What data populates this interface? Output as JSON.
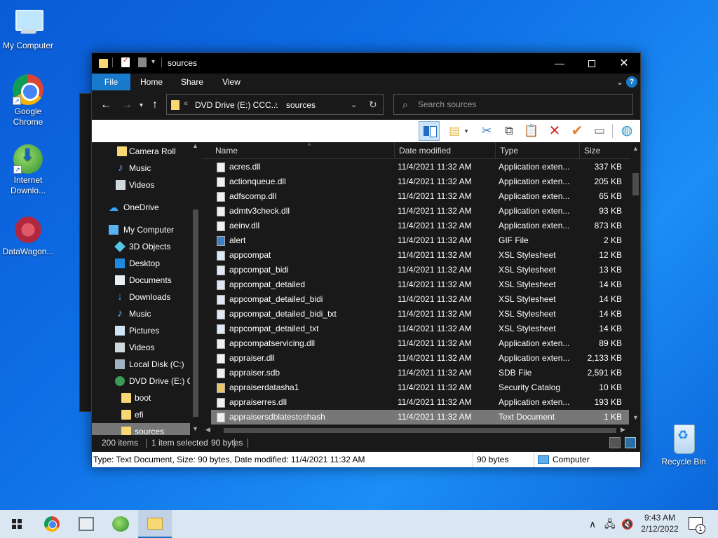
{
  "desktop": {
    "icons": [
      {
        "label": "My Computer"
      },
      {
        "label": "Google Chrome"
      },
      {
        "label": "Internet Downlo..."
      },
      {
        "label": "DataWagon..."
      },
      {
        "label": "Recycle Bin"
      }
    ]
  },
  "window": {
    "title": "sources",
    "controls": {
      "minimize": "—",
      "maximize": "",
      "close": "✕"
    },
    "ribbon_tabs": [
      "File",
      "Home",
      "Share",
      "View"
    ],
    "help": "?",
    "address": {
      "chevron": "«",
      "segments": [
        "DVD Drive (E:) CCC...",
        "sources"
      ],
      "arrow": "›"
    },
    "search": {
      "placeholder": "Search sources"
    },
    "nav_pane": [
      {
        "label": "Camera Roll",
        "icon": "folder-icon"
      },
      {
        "label": "Music",
        "icon": "music-icon"
      },
      {
        "label": "Videos",
        "icon": "videos-icon"
      },
      {
        "label": "OneDrive",
        "icon": "cloud-icon"
      },
      {
        "label": "My Computer",
        "icon": "computer-icon"
      },
      {
        "label": "3D Objects",
        "icon": "3d-objects-icon"
      },
      {
        "label": "Desktop",
        "icon": "desktop-icon"
      },
      {
        "label": "Documents",
        "icon": "documents-icon"
      },
      {
        "label": "Downloads",
        "icon": "downloads-icon"
      },
      {
        "label": "Music",
        "icon": "music-icon"
      },
      {
        "label": "Pictures",
        "icon": "pictures-icon"
      },
      {
        "label": "Videos",
        "icon": "videos-icon"
      },
      {
        "label": "Local Disk (C:)",
        "icon": "disk-icon"
      },
      {
        "label": "DVD Drive (E:) CC",
        "icon": "dvd-icon"
      },
      {
        "label": "boot",
        "icon": "folder-icon"
      },
      {
        "label": "efi",
        "icon": "folder-icon"
      },
      {
        "label": "sources",
        "icon": "folder-icon",
        "selected": true
      }
    ],
    "columns": {
      "name": "Name",
      "date": "Date modified",
      "type": "Type",
      "size": "Size"
    },
    "files": [
      {
        "name": "acres.dll",
        "date": "11/4/2021 11:32 AM",
        "type": "Application exten...",
        "size": "337 KB",
        "kind": "dll"
      },
      {
        "name": "actionqueue.dll",
        "date": "11/4/2021 11:32 AM",
        "type": "Application exten...",
        "size": "205 KB",
        "kind": "dll"
      },
      {
        "name": "adfscomp.dll",
        "date": "11/4/2021 11:32 AM",
        "type": "Application exten...",
        "size": "65 KB",
        "kind": "dll"
      },
      {
        "name": "admtv3check.dll",
        "date": "11/4/2021 11:32 AM",
        "type": "Application exten...",
        "size": "93 KB",
        "kind": "dll"
      },
      {
        "name": "aeinv.dll",
        "date": "11/4/2021 11:32 AM",
        "type": "Application exten...",
        "size": "873 KB",
        "kind": "dll"
      },
      {
        "name": "alert",
        "date": "11/4/2021 11:32 AM",
        "type": "GIF File",
        "size": "2 KB",
        "kind": "gif"
      },
      {
        "name": "appcompat",
        "date": "11/4/2021 11:32 AM",
        "type": "XSL Stylesheet",
        "size": "12 KB",
        "kind": "xsl"
      },
      {
        "name": "appcompat_bidi",
        "date": "11/4/2021 11:32 AM",
        "type": "XSL Stylesheet",
        "size": "13 KB",
        "kind": "xsl"
      },
      {
        "name": "appcompat_detailed",
        "date": "11/4/2021 11:32 AM",
        "type": "XSL Stylesheet",
        "size": "14 KB",
        "kind": "xsl"
      },
      {
        "name": "appcompat_detailed_bidi",
        "date": "11/4/2021 11:32 AM",
        "type": "XSL Stylesheet",
        "size": "14 KB",
        "kind": "xsl"
      },
      {
        "name": "appcompat_detailed_bidi_txt",
        "date": "11/4/2021 11:32 AM",
        "type": "XSL Stylesheet",
        "size": "14 KB",
        "kind": "xsl"
      },
      {
        "name": "appcompat_detailed_txt",
        "date": "11/4/2021 11:32 AM",
        "type": "XSL Stylesheet",
        "size": "14 KB",
        "kind": "xsl"
      },
      {
        "name": "appcompatservicing.dll",
        "date": "11/4/2021 11:32 AM",
        "type": "Application exten...",
        "size": "89 KB",
        "kind": "dll"
      },
      {
        "name": "appraiser.dll",
        "date": "11/4/2021 11:32 AM",
        "type": "Application exten...",
        "size": "2,133 KB",
        "kind": "dll"
      },
      {
        "name": "appraiser.sdb",
        "date": "11/4/2021 11:32 AM",
        "type": "SDB File",
        "size": "2,591 KB",
        "kind": "file"
      },
      {
        "name": "appraiserdatasha1",
        "date": "11/4/2021 11:32 AM",
        "type": "Security Catalog",
        "size": "10 KB",
        "kind": "cat"
      },
      {
        "name": "appraiserres.dll",
        "date": "11/4/2021 11:32 AM",
        "type": "Application exten...",
        "size": "193 KB",
        "kind": "dll"
      },
      {
        "name": "appraisersdblatestoshash",
        "date": "11/4/2021 11:32 AM",
        "type": "Text Document",
        "size": "1 KB",
        "kind": "txt",
        "selected": true
      }
    ],
    "status": {
      "count": "200 items",
      "selected": "1 item selected",
      "size": "90 bytes"
    },
    "details": {
      "info": "Type: Text Document, Size: 90 bytes, Date modified: 11/4/2021 11:32 AM",
      "size": "90 bytes",
      "location": "Computer"
    }
  },
  "taskbar": {
    "time": "9:43 AM",
    "date": "2/12/2022",
    "notification_count": "1"
  }
}
